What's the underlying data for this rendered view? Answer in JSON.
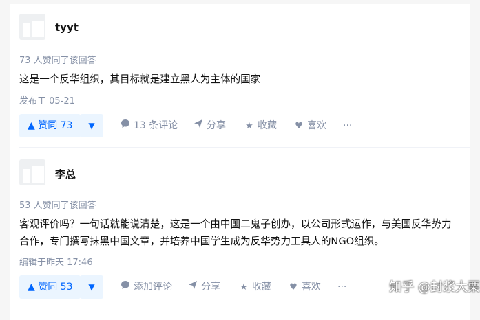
{
  "answers": [
    {
      "author": "tyyt",
      "voters": "73 人赞同了该回答",
      "content": "这是一个反华组织，其目标就是建立黑人为主体的国家",
      "time": "发布于 05-21",
      "vote_label": "▲ 赞同 73",
      "comments": "13 条评论",
      "share": "分享",
      "collect": "收藏",
      "like": "喜欢",
      "more": "···"
    },
    {
      "author": "李总",
      "voters": "53 人赞同了该回答",
      "content_line1": "客观评价吗？一句话就能说清楚，这是一个由中国二鬼子创办，以公司形式运作，与美国反华势力",
      "content_line2": "合作，专门撰写抹黑中国文章，并培养中国学生成为反华势力工具人的NGO组织。",
      "time": "编辑于昨天 17:46",
      "vote_label": "▲ 赞同 53",
      "comments": "添加评论",
      "share": "分享",
      "collect": "收藏",
      "like": "喜欢",
      "more": "···"
    }
  ],
  "watermark": "知乎 @封浆大栗",
  "icons": {
    "vote_down": "▼",
    "comment": "comment-icon",
    "share": "share-icon",
    "collect": "star-icon",
    "like": "heart-icon"
  },
  "colors": {
    "accent": "#0066ff",
    "accent_bg": "#ebf5ff",
    "meta": "#8590a6"
  }
}
